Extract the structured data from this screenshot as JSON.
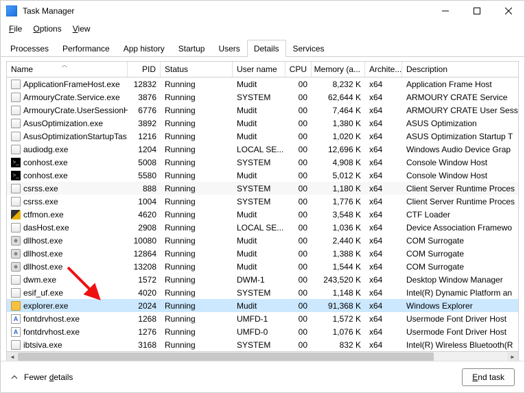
{
  "window": {
    "title": "Task Manager"
  },
  "menu": {
    "file": "File",
    "options": "Options",
    "view": "View"
  },
  "tabs": {
    "items": [
      "Processes",
      "Performance",
      "App history",
      "Startup",
      "Users",
      "Details",
      "Services"
    ],
    "active": 5
  },
  "columns": {
    "name": "Name",
    "pid": "PID",
    "status": "Status",
    "user": "User name",
    "cpu": "CPU",
    "mem": "Memory (a...",
    "arch": "Archite...",
    "desc": "Description"
  },
  "rows": [
    {
      "icon": "app",
      "name": "ApplicationFrameHost.exe",
      "pid": "12832",
      "status": "Running",
      "user": "Mudit",
      "cpu": "00",
      "mem": "8,232 K",
      "arch": "x64",
      "desc": "Application Frame Host"
    },
    {
      "icon": "app",
      "name": "ArmouryCrate.Service.exe",
      "pid": "3876",
      "status": "Running",
      "user": "SYSTEM",
      "cpu": "00",
      "mem": "62,644 K",
      "arch": "x64",
      "desc": "ARMOURY CRATE Service"
    },
    {
      "icon": "app",
      "name": "ArmouryCrate.UserSessionH...",
      "pid": "6776",
      "status": "Running",
      "user": "Mudit",
      "cpu": "00",
      "mem": "7,464 K",
      "arch": "x64",
      "desc": "ARMOURY CRATE User Sessi"
    },
    {
      "icon": "app",
      "name": "AsusOptimization.exe",
      "pid": "3892",
      "status": "Running",
      "user": "Mudit",
      "cpu": "00",
      "mem": "1,380 K",
      "arch": "x64",
      "desc": "ASUS Optimization"
    },
    {
      "icon": "app",
      "name": "AsusOptimizationStartupTas...",
      "pid": "1216",
      "status": "Running",
      "user": "Mudit",
      "cpu": "00",
      "mem": "1,020 K",
      "arch": "x64",
      "desc": "ASUS Optimization Startup T"
    },
    {
      "icon": "app",
      "name": "audiodg.exe",
      "pid": "1204",
      "status": "Running",
      "user": "LOCAL SE...",
      "cpu": "00",
      "mem": "12,696 K",
      "arch": "x64",
      "desc": "Windows Audio Device Grap"
    },
    {
      "icon": "term",
      "name": "conhost.exe",
      "pid": "5008",
      "status": "Running",
      "user": "SYSTEM",
      "cpu": "00",
      "mem": "4,908 K",
      "arch": "x64",
      "desc": "Console Window Host"
    },
    {
      "icon": "term",
      "name": "conhost.exe",
      "pid": "5580",
      "status": "Running",
      "user": "Mudit",
      "cpu": "00",
      "mem": "5,012 K",
      "arch": "x64",
      "desc": "Console Window Host"
    },
    {
      "icon": "app",
      "name": "csrss.exe",
      "pid": "888",
      "status": "Running",
      "user": "SYSTEM",
      "cpu": "00",
      "mem": "1,180 K",
      "arch": "x64",
      "desc": "Client Server Runtime Proces",
      "alt": true
    },
    {
      "icon": "app",
      "name": "csrss.exe",
      "pid": "1004",
      "status": "Running",
      "user": "SYSTEM",
      "cpu": "00",
      "mem": "1,776 K",
      "arch": "x64",
      "desc": "Client Server Runtime Proces"
    },
    {
      "icon": "pen",
      "name": "ctfmon.exe",
      "pid": "4620",
      "status": "Running",
      "user": "Mudit",
      "cpu": "00",
      "mem": "3,548 K",
      "arch": "x64",
      "desc": "CTF Loader"
    },
    {
      "icon": "app",
      "name": "dasHost.exe",
      "pid": "2908",
      "status": "Running",
      "user": "LOCAL SE...",
      "cpu": "00",
      "mem": "1,036 K",
      "arch": "x64",
      "desc": "Device Association Framewo"
    },
    {
      "icon": "cog",
      "name": "dllhost.exe",
      "pid": "10080",
      "status": "Running",
      "user": "Mudit",
      "cpu": "00",
      "mem": "2,440 K",
      "arch": "x64",
      "desc": "COM Surrogate"
    },
    {
      "icon": "cog",
      "name": "dllhost.exe",
      "pid": "12864",
      "status": "Running",
      "user": "Mudit",
      "cpu": "00",
      "mem": "1,388 K",
      "arch": "x64",
      "desc": "COM Surrogate"
    },
    {
      "icon": "cog",
      "name": "dllhost.exe",
      "pid": "13208",
      "status": "Running",
      "user": "Mudit",
      "cpu": "00",
      "mem": "1,544 K",
      "arch": "x64",
      "desc": "COM Surrogate"
    },
    {
      "icon": "app",
      "name": "dwm.exe",
      "pid": "1572",
      "status": "Running",
      "user": "DWM-1",
      "cpu": "00",
      "mem": "243,520 K",
      "arch": "x64",
      "desc": "Desktop Window Manager"
    },
    {
      "icon": "app",
      "name": "esif_uf.exe",
      "pid": "4020",
      "status": "Running",
      "user": "SYSTEM",
      "cpu": "00",
      "mem": "1,148 K",
      "arch": "x64",
      "desc": "Intel(R) Dynamic Platform an"
    },
    {
      "icon": "folder",
      "name": "explorer.exe",
      "pid": "2024",
      "status": "Running",
      "user": "Mudit",
      "cpu": "00",
      "mem": "91,368 K",
      "arch": "x64",
      "desc": "Windows Explorer",
      "sel": true
    },
    {
      "icon": "font",
      "name": "fontdrvhost.exe",
      "pid": "1268",
      "status": "Running",
      "user": "UMFD-1",
      "cpu": "00",
      "mem": "1,572 K",
      "arch": "x64",
      "desc": "Usermode Font Driver Host"
    },
    {
      "icon": "font",
      "name": "fontdrvhost.exe",
      "pid": "1276",
      "status": "Running",
      "user": "UMFD-0",
      "cpu": "00",
      "mem": "1,076 K",
      "arch": "x64",
      "desc": "Usermode Font Driver Host"
    },
    {
      "icon": "app",
      "name": "ibtsiva.exe",
      "pid": "3168",
      "status": "Running",
      "user": "SYSTEM",
      "cpu": "00",
      "mem": "832 K",
      "arch": "x64",
      "desc": "Intel(R) Wireless Bluetooth(R"
    }
  ],
  "footer": {
    "fewer": "Fewer details",
    "end": "End task"
  }
}
